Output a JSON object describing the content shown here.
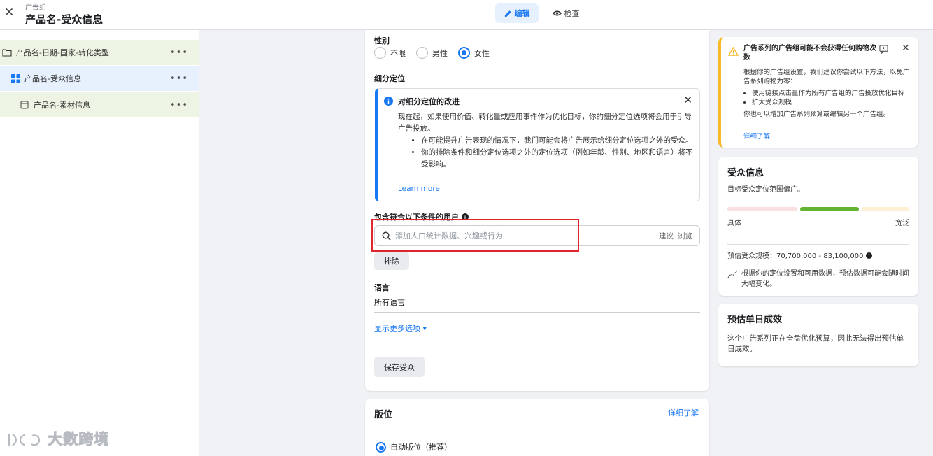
{
  "header": {
    "breadcrumb": "广告组",
    "title": "产品名-受众信息",
    "tabs": [
      {
        "label": "编辑",
        "active": true
      },
      {
        "label": "检查",
        "active": false
      }
    ]
  },
  "sidebar": {
    "items": [
      {
        "label": "产品名-日期-国家-转化类型",
        "icon": "folder-icon"
      },
      {
        "label": "产品名-受众信息",
        "icon": "grid-icon"
      },
      {
        "label": "产品名-素材信息",
        "icon": "ad-icon"
      }
    ],
    "more": "•••"
  },
  "audience_form": {
    "gender_label": "性别",
    "gender_options": [
      "不限",
      "男性",
      "女性"
    ],
    "gender_selected": "女性",
    "detailed_targeting_label": "细分定位",
    "notice": {
      "title": "对细分定位的改进",
      "body": "现在起，如果使用价值、转化量或应用事件作为优化目标，你的细分定位选项将会用于引导广告投放。",
      "bullets": [
        "在可能提升广告表现的情况下，我们可能会将广告展示给细分定位选项之外的受众。",
        "你的排除条件和细分定位选项之外的定位选项（例如年龄、性别、地区和语言）将不受影响。"
      ],
      "link": "Learn more."
    },
    "include_label": "包含符合以下条件的用户",
    "search_placeholder": "添加人口统计数据、兴趣或行为",
    "suggest": "建议",
    "browse": "浏览",
    "exclude_button": "排除",
    "language_label": "语言",
    "language_value": "所有语言",
    "more_options": "显示更多选项 ▾",
    "save_audience": "保存受众"
  },
  "placements": {
    "title": "版位",
    "learn_more": "详细了解",
    "auto_option": "自动版位（推荐）"
  },
  "warning": {
    "title": "广告系列的广告组可能不会获得任何购物次数",
    "body": "根据你的广告组设置，我们建议你尝试以下方法，以免广告系列购物为零：",
    "bullets": [
      "使用链接点击量作为所有广告组的广告投放优化目标",
      "扩大受众规模"
    ],
    "footer": "你也可以增加广告系列预算或编辑另一个广告组。",
    "link": "详细了解"
  },
  "audience_info": {
    "title": "受众信息",
    "subtitle": "目标受众定位范围偏广。",
    "specific": "具体",
    "broad": "宽泛",
    "estimate": "预估受众规模：70,700,000 - 83,100,000",
    "note": "根据你的定位设置和可用数据，预估数据可能会随时间大幅变化。",
    "meter_level": 0.56,
    "colors": {
      "specific": "#f8e1e0",
      "ok": "#62b32f",
      "broad": "#fdf0d5"
    }
  },
  "daily_results": {
    "title": "预估单日成效",
    "text": "这个广告系列正在全盘优化预算，因此无法得出预估单日成效。"
  },
  "watermark": "大数跨境",
  "colors": {
    "accent": "#1877f2",
    "highlight": "#e0252f",
    "warning": "#f7b928"
  }
}
